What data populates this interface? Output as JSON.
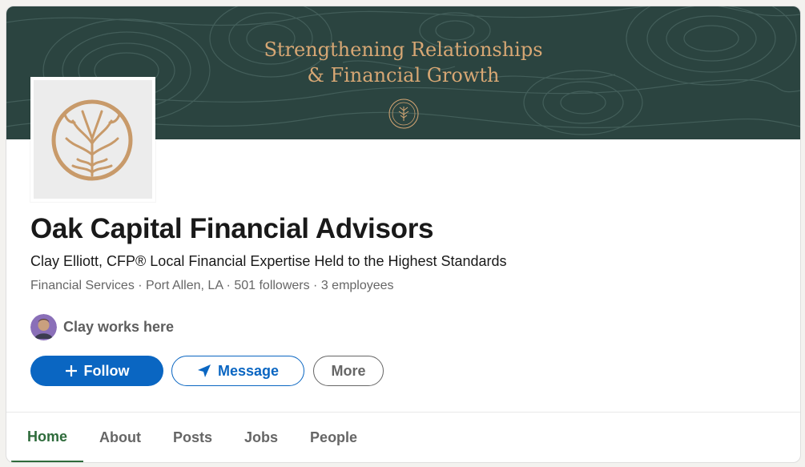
{
  "banner": {
    "line1": "Strengthening Relationships",
    "line2": "& Financial Growth",
    "background": "#2b4440",
    "text_color": "#d7a774",
    "seal_icon": "oak-capital-seal"
  },
  "company": {
    "logo_icon": "tree-circle-logo",
    "name": "Oak Capital Financial Advisors",
    "tagline": "Clay Elliott, CFP® Local Financial Expertise Held to the Highest Standards",
    "meta": {
      "industry": "Financial Services",
      "location": "Port Allen, LA",
      "followers": "501 followers",
      "employees": "3 employees",
      "separator": " · "
    }
  },
  "connection": {
    "avatar_icon": "user-avatar",
    "text": "Clay works here"
  },
  "actions": {
    "follow_label": "Follow",
    "follow_icon": "plus-icon",
    "message_label": "Message",
    "message_icon": "send-icon",
    "more_label": "More"
  },
  "tabs": [
    {
      "label": "Home",
      "active": true
    },
    {
      "label": "About",
      "active": false
    },
    {
      "label": "Posts",
      "active": false
    },
    {
      "label": "Jobs",
      "active": false
    },
    {
      "label": "People",
      "active": false
    }
  ],
  "colors": {
    "primary": "#0a66c2",
    "active_tab": "#2e6b3b",
    "logo_gold": "#c89a6a"
  }
}
